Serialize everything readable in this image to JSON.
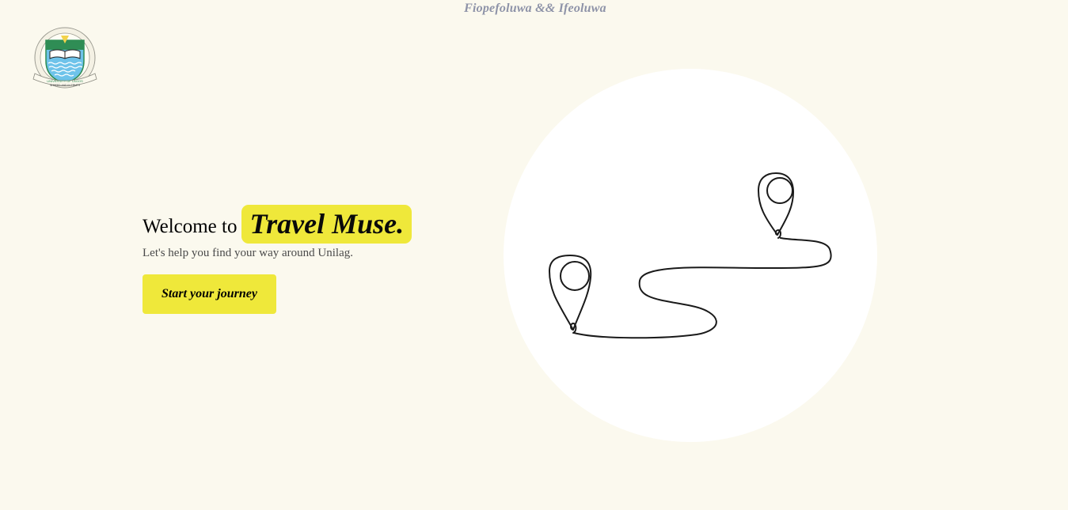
{
  "header": {
    "credits": "Fiopefoluwa && Ifeoluwa"
  },
  "logo": {
    "icon": "university-crest-icon",
    "ring_text": "UNIVERSITY OF LAGOS",
    "motto": "IN DEED AND IN TRUTH"
  },
  "hero": {
    "welcome": "Welcome to",
    "brand": "Travel Muse.",
    "tagline": "Let's help you find your way around Unilag.",
    "cta_label": "Start your journey"
  },
  "illustration": {
    "icon": "route-map-pins-icon"
  },
  "colors": {
    "background": "#fbf9ee",
    "accent": "#efe83a",
    "credits_text": "#8e93a8",
    "circle": "#ffffff"
  }
}
